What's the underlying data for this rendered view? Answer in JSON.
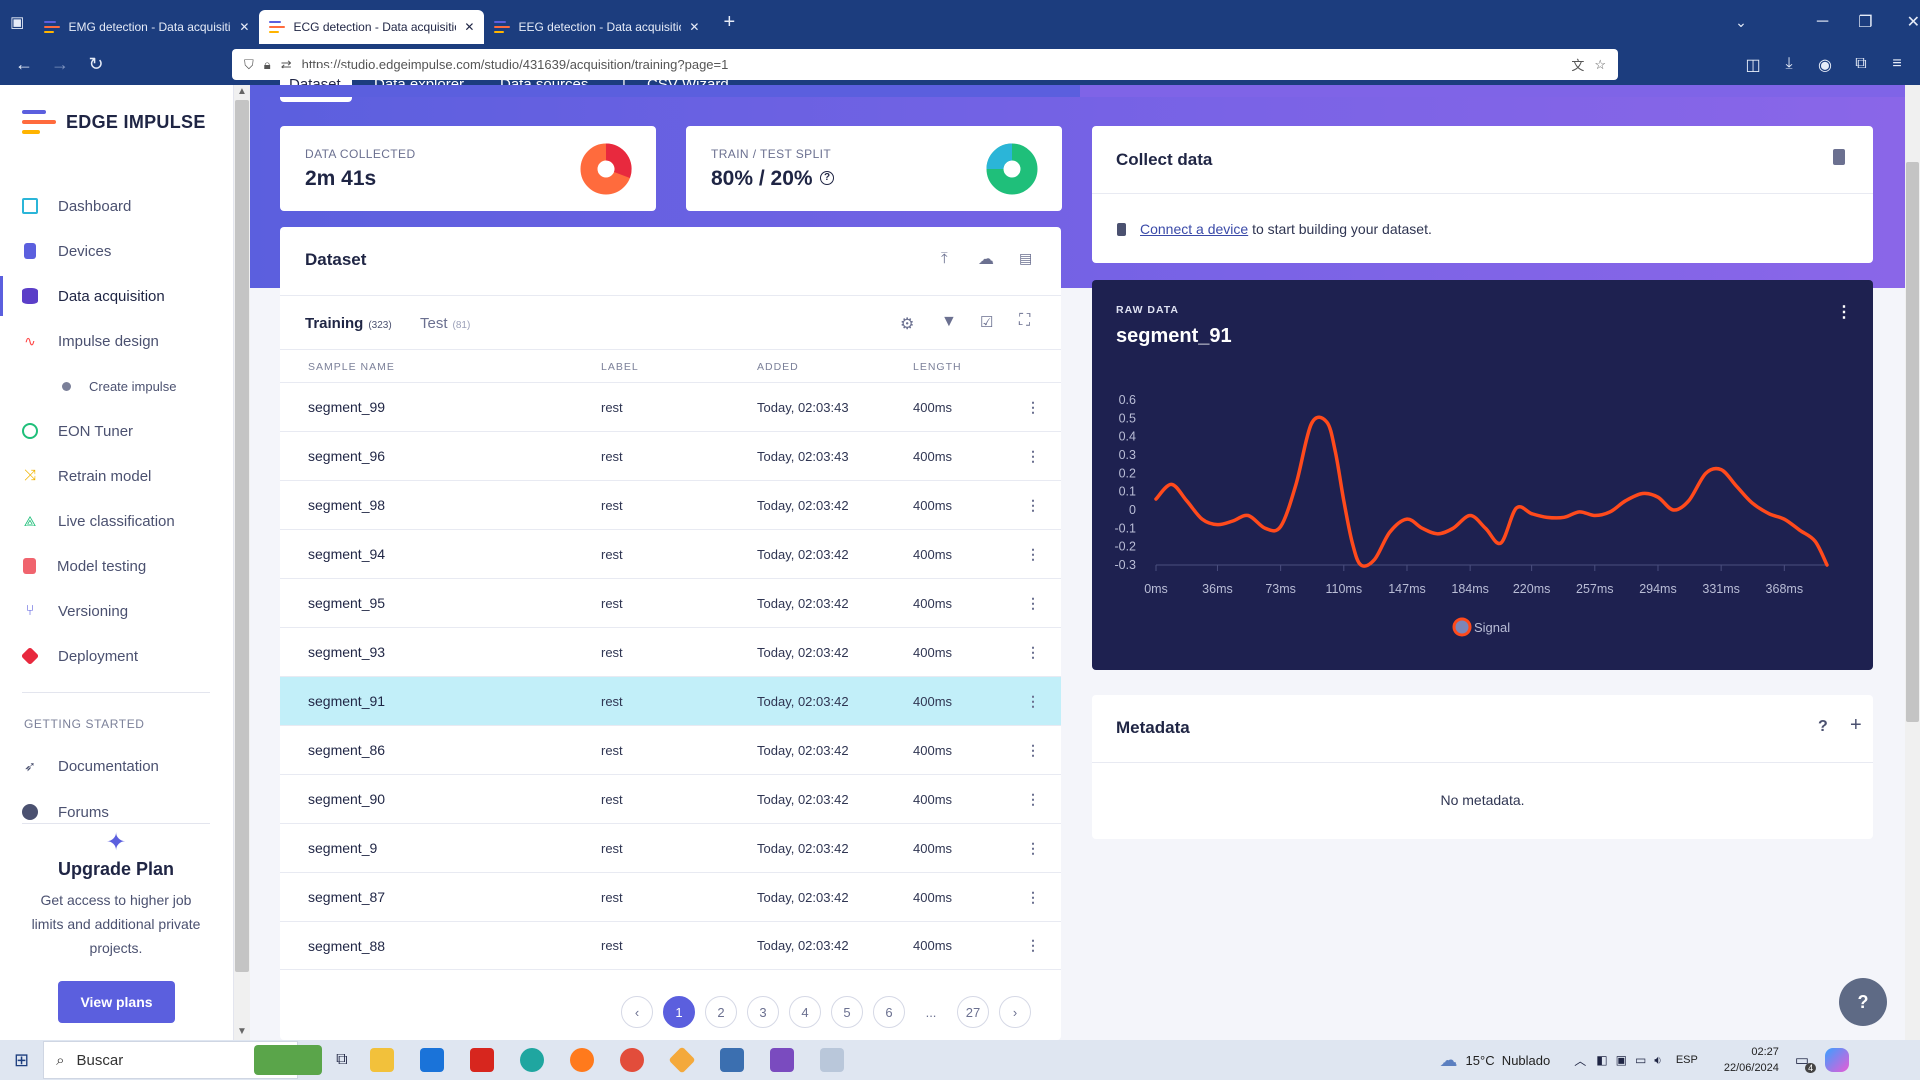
{
  "browser": {
    "tabs": [
      {
        "title": "EMG detection - Data acquisitio",
        "active": false
      },
      {
        "title": "ECG detection - Data acquisitio",
        "active": true
      },
      {
        "title": "EEG detection - Data acquisitio",
        "active": false
      }
    ],
    "url": "https://studio.edgeimpulse.com/studio/431639/acquisition/training?page=1"
  },
  "sidebar": {
    "brand": "EDGE IMPULSE",
    "items": [
      {
        "label": "Dashboard",
        "icon": "monitor-icon"
      },
      {
        "label": "Devices",
        "icon": "chip-icon"
      },
      {
        "label": "Data acquisition",
        "icon": "database-icon",
        "active": true
      },
      {
        "label": "Impulse design",
        "icon": "pulse-icon"
      },
      {
        "label": "Create impulse",
        "icon": "dot-icon",
        "sub": true
      },
      {
        "label": "EON Tuner",
        "icon": "tuner-icon"
      },
      {
        "label": "Retrain model",
        "icon": "shuffle-icon"
      },
      {
        "label": "Live classification",
        "icon": "network-icon"
      },
      {
        "label": "Model testing",
        "icon": "clipboard-icon"
      },
      {
        "label": "Versioning",
        "icon": "branch-icon"
      },
      {
        "label": "Deployment",
        "icon": "cube-icon"
      }
    ],
    "getting_started": "GETTING STARTED",
    "gs_items": [
      {
        "label": "Documentation",
        "icon": "rocket-icon"
      },
      {
        "label": "Forums",
        "icon": "chat-icon"
      }
    ],
    "upgrade_title": "Upgrade Plan",
    "upgrade_text": "Get access to higher job limits and additional private projects.",
    "view_plans": "View plans"
  },
  "top_tabs": [
    "Dataset",
    "Data explorer",
    "Data sources",
    "|",
    "CSV Wizard"
  ],
  "stats": {
    "collected_label": "DATA COLLECTED",
    "collected_value": "2m 41s",
    "split_label": "TRAIN / TEST SPLIT",
    "split_value": "80% / 20%"
  },
  "dataset": {
    "title": "Dataset",
    "training_label": "Training",
    "training_count": "(323)",
    "test_label": "Test",
    "test_count": "(81)",
    "columns": [
      "SAMPLE NAME",
      "LABEL",
      "ADDED",
      "LENGTH"
    ],
    "rows": [
      {
        "name": "segment_99",
        "label": "rest",
        "added": "Today, 02:03:43",
        "length": "400ms"
      },
      {
        "name": "segment_96",
        "label": "rest",
        "added": "Today, 02:03:43",
        "length": "400ms"
      },
      {
        "name": "segment_98",
        "label": "rest",
        "added": "Today, 02:03:42",
        "length": "400ms"
      },
      {
        "name": "segment_94",
        "label": "rest",
        "added": "Today, 02:03:42",
        "length": "400ms"
      },
      {
        "name": "segment_95",
        "label": "rest",
        "added": "Today, 02:03:42",
        "length": "400ms"
      },
      {
        "name": "segment_93",
        "label": "rest",
        "added": "Today, 02:03:42",
        "length": "400ms"
      },
      {
        "name": "segment_91",
        "label": "rest",
        "added": "Today, 02:03:42",
        "length": "400ms",
        "selected": true
      },
      {
        "name": "segment_86",
        "label": "rest",
        "added": "Today, 02:03:42",
        "length": "400ms"
      },
      {
        "name": "segment_90",
        "label": "rest",
        "added": "Today, 02:03:42",
        "length": "400ms"
      },
      {
        "name": "segment_9",
        "label": "rest",
        "added": "Today, 02:03:42",
        "length": "400ms"
      },
      {
        "name": "segment_87",
        "label": "rest",
        "added": "Today, 02:03:42",
        "length": "400ms"
      },
      {
        "name": "segment_88",
        "label": "rest",
        "added": "Today, 02:03:42",
        "length": "400ms"
      }
    ],
    "pages": [
      "1",
      "2",
      "3",
      "4",
      "5",
      "6",
      "...",
      "27"
    ],
    "current_page": "1"
  },
  "collect": {
    "title": "Collect data",
    "link": "Connect a device",
    "text": " to start building your dataset."
  },
  "raw": {
    "label": "RAW DATA",
    "title": "segment_91"
  },
  "chart_data": {
    "type": "line",
    "x": [
      0,
      9,
      18,
      27,
      36,
      45,
      54,
      64,
      73,
      82,
      91,
      100,
      105,
      110,
      115,
      120,
      128,
      137,
      147,
      156,
      165,
      174,
      184,
      193,
      202,
      211,
      220,
      229,
      239,
      248,
      257,
      266,
      275,
      285,
      294,
      303,
      312,
      322,
      331,
      340,
      349,
      359,
      368,
      377,
      386,
      393
    ],
    "series": [
      {
        "name": "Signal",
        "color": "#ff4a1c",
        "values": [
          0.06,
          0.14,
          0.05,
          -0.05,
          -0.08,
          -0.06,
          -0.03,
          -0.1,
          -0.09,
          0.14,
          0.47,
          0.48,
          0.32,
          0.05,
          -0.18,
          -0.3,
          -0.27,
          -0.12,
          -0.05,
          -0.1,
          -0.13,
          -0.1,
          -0.03,
          -0.1,
          -0.18,
          0.01,
          -0.02,
          -0.04,
          -0.04,
          -0.01,
          -0.03,
          -0.01,
          0.05,
          0.09,
          0.07,
          0.0,
          0.05,
          0.2,
          0.22,
          0.13,
          0.04,
          -0.02,
          -0.05,
          -0.11,
          -0.17,
          -0.3
        ]
      }
    ],
    "yticks": [
      "0.6",
      "0.5",
      "0.4",
      "0.3",
      "0.2",
      "0.1",
      "0",
      "-0.1",
      "-0.2",
      "-0.3"
    ],
    "xticks": [
      "0ms",
      "36ms",
      "73ms",
      "110ms",
      "147ms",
      "184ms",
      "220ms",
      "257ms",
      "294ms",
      "331ms",
      "368ms"
    ],
    "ylim": [
      -0.3,
      0.6
    ],
    "xlim": [
      0,
      393
    ],
    "legend_position": "bottom-center"
  },
  "metadata": {
    "title": "Metadata",
    "empty": "No metadata."
  },
  "taskbar": {
    "search": "Buscar",
    "weather": "15°C  Nublado",
    "lang": "ESP",
    "time": "02:27",
    "date": "22/06/2024",
    "notif": "4"
  }
}
